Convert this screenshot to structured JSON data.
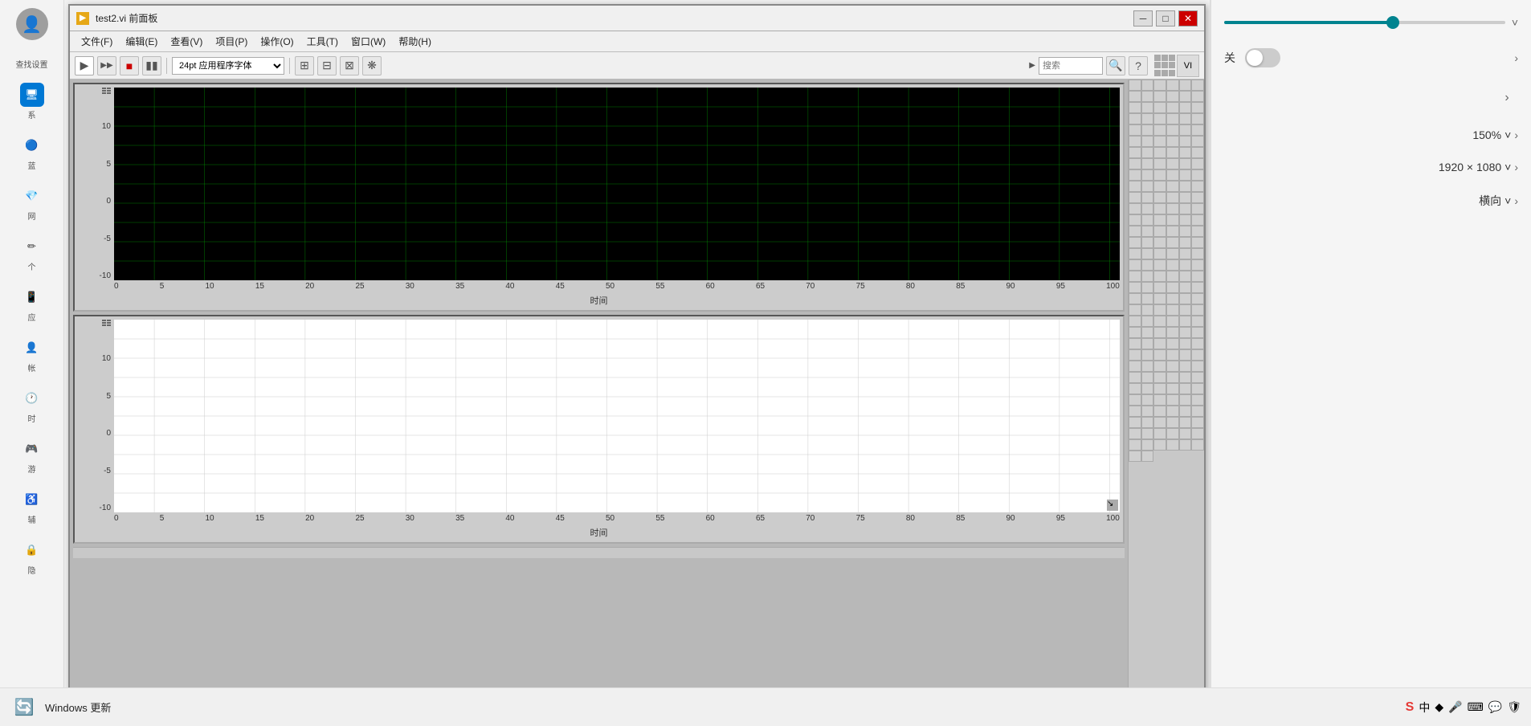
{
  "window": {
    "title": "test2.vi 前面板",
    "title_icon": "▶",
    "btn_minimize": "─",
    "btn_maximize": "□",
    "btn_close": "✕"
  },
  "menubar": {
    "items": [
      {
        "label": "文件(F)"
      },
      {
        "label": "编辑(E)"
      },
      {
        "label": "查看(V)"
      },
      {
        "label": "项目(P)"
      },
      {
        "label": "操作(O)"
      },
      {
        "label": "工具(T)"
      },
      {
        "label": "窗口(W)"
      },
      {
        "label": "帮助(H)"
      }
    ]
  },
  "toolbar": {
    "font_select": "24pt 应用程序字体",
    "search_placeholder": "搜索"
  },
  "chart_top": {
    "y_axis_labels": [
      "10",
      "5",
      "0",
      "-5",
      "-10"
    ],
    "x_axis_labels": [
      "0",
      "5",
      "10",
      "15",
      "20",
      "25",
      "30",
      "35",
      "40",
      "45",
      "50",
      "55",
      "60",
      "65",
      "70",
      "75",
      "80",
      "85",
      "90",
      "95",
      "100"
    ],
    "x_label": "时间",
    "type": "dark"
  },
  "chart_bottom": {
    "y_axis_labels": [
      "10",
      "5",
      "0",
      "-5",
      "-10"
    ],
    "x_axis_labels": [
      "0",
      "5",
      "10",
      "15",
      "20",
      "25",
      "30",
      "35",
      "40",
      "45",
      "50",
      "55",
      "60",
      "65",
      "70",
      "75",
      "80",
      "85",
      "90",
      "95",
      "100"
    ],
    "x_label": "时间",
    "type": "light"
  },
  "sidebar": {
    "avatar_icon": "👤",
    "find_settings_label": "查找设置",
    "items": [
      {
        "label": "系",
        "icon": "🖥",
        "active": true
      },
      {
        "label": "蓝",
        "icon": "🔵"
      },
      {
        "label": "网",
        "icon": "💎"
      },
      {
        "label": "个",
        "icon": "✏"
      },
      {
        "label": "应",
        "icon": "📱"
      },
      {
        "label": "帐",
        "icon": "👤"
      },
      {
        "label": "时",
        "icon": "🕐"
      },
      {
        "label": "游",
        "icon": "🎮"
      },
      {
        "label": "辅",
        "icon": "♿"
      },
      {
        "label": "隐",
        "icon": "🔒"
      }
    ]
  },
  "right_panel": {
    "slider_value": "60%",
    "toggle_label": "关",
    "toggle_chevron": "›",
    "arrow_chevron": "›",
    "percentage": "150%",
    "percentage_chevron": "˅",
    "percentage_arrow": "›",
    "resolution": "1920 × 1080",
    "resolution_chevron": "˅",
    "resolution_arrow": "›",
    "orientation": "横向",
    "orientation_chevron": "˅",
    "orientation_arrow": "›"
  },
  "taskbar": {
    "windows_update_label": "Windows 更新",
    "update_icon": "🔄",
    "icons": [
      "中",
      "◆",
      "🎤",
      "⌨",
      "💬",
      "🛡"
    ]
  }
}
